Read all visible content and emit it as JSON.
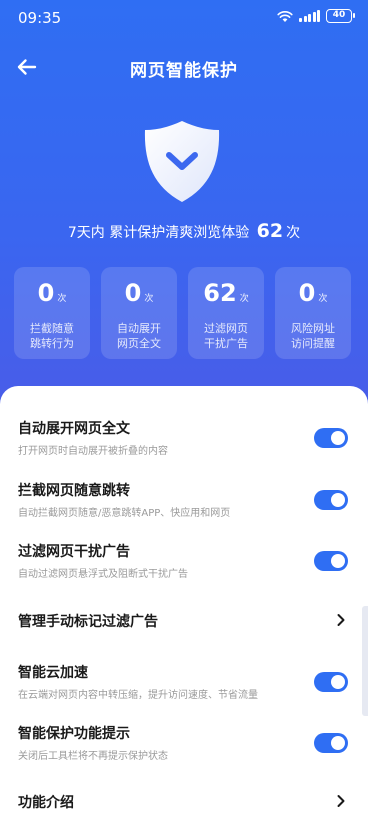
{
  "status": {
    "time": "09:35",
    "battery": "40"
  },
  "header": {
    "title": "网页智能保护"
  },
  "summary": {
    "prefix": "7天内 累计保护清爽浏览体验",
    "count": "62",
    "suffix": "次"
  },
  "stats": [
    {
      "value": "0",
      "unit": "次",
      "line1": "拦截随意",
      "line2": "跳转行为"
    },
    {
      "value": "0",
      "unit": "次",
      "line1": "自动展开",
      "line2": "网页全文"
    },
    {
      "value": "62",
      "unit": "次",
      "line1": "过滤网页",
      "line2": "干扰广告"
    },
    {
      "value": "0",
      "unit": "次",
      "line1": "风险网址",
      "line2": "访问提醒"
    }
  ],
  "settings": [
    {
      "title": "自动展开网页全文",
      "subtitle": "打开网页时自动展开被折叠的内容",
      "enabled": true
    },
    {
      "title": "拦截网页随意跳转",
      "subtitle": "自动拦截网页随意/恶意跳转APP、快应用和网页",
      "enabled": true
    },
    {
      "title": "过滤网页干扰广告",
      "subtitle": "自动过滤网页悬浮式及阻断式干扰广告",
      "enabled": true
    },
    {
      "title": "管理手动标记过滤广告"
    },
    {
      "title": "智能云加速",
      "subtitle": "在云端对网页内容中转压缩，提升访问速度、节省流量",
      "enabled": true
    },
    {
      "title": "智能保护功能提示",
      "subtitle": "关闭后工具栏将不再提示保护状态",
      "enabled": true
    },
    {
      "title": "功能介绍"
    }
  ],
  "colors": {
    "accent": "#2f6ef3",
    "hero_top": "#2f6ef3",
    "hero_bottom": "#4a5ce8"
  }
}
